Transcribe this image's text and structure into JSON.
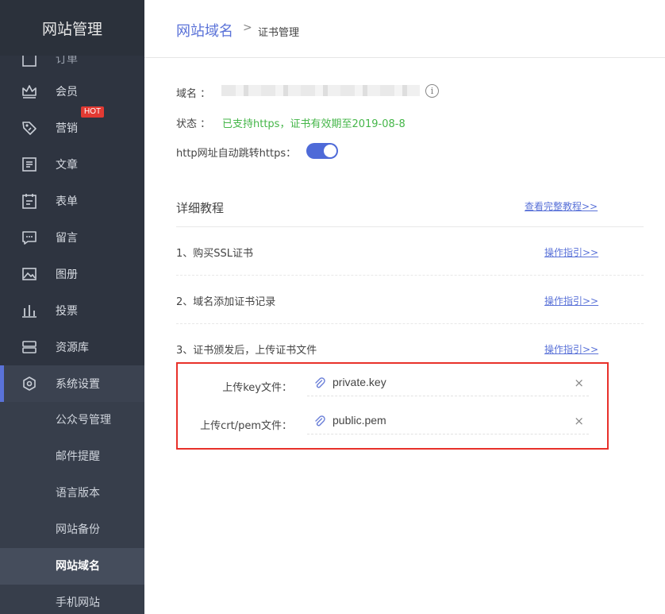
{
  "sidebar": {
    "brand": "网站管理",
    "partial_label": "订单",
    "hot_badge": "HOT",
    "items": [
      {
        "label": "会员",
        "icon": "crown-icon"
      },
      {
        "label": "营销",
        "icon": "tag-icon"
      },
      {
        "label": "文章",
        "icon": "article-icon"
      },
      {
        "label": "表单",
        "icon": "form-icon"
      },
      {
        "label": "留言",
        "icon": "message-icon"
      },
      {
        "label": "图册",
        "icon": "image-icon"
      },
      {
        "label": "投票",
        "icon": "bar-chart-icon"
      },
      {
        "label": "资源库",
        "icon": "storage-icon"
      },
      {
        "label": "系统设置",
        "icon": "settings-icon"
      }
    ],
    "subitems": [
      {
        "label": "公众号管理"
      },
      {
        "label": "邮件提醒"
      },
      {
        "label": "语言版本"
      },
      {
        "label": "网站备份"
      },
      {
        "label": "网站域名"
      },
      {
        "label": "手机网站"
      }
    ]
  },
  "header": {
    "breadcrumb_main": "网站域名",
    "breadcrumb_sep": ">",
    "breadcrumb_sub": "证书管理"
  },
  "info": {
    "domain_label": "域名 ：",
    "status_label": "状态 ：",
    "status_value": "已支持https，证书有效期至2019-08-8",
    "redirect_label": "http网址自动跳转https：",
    "redirect_enabled": true
  },
  "tutorial": {
    "title": "详细教程",
    "full_link": "查看完整教程>>",
    "steps": [
      {
        "text": "1、购买SSL证书",
        "link": "操作指引>>"
      },
      {
        "text": "2、域名添加证书记录",
        "link": "操作指引>>"
      },
      {
        "text": "3、证书颁发后，上传证书文件",
        "link": "操作指引>>"
      }
    ]
  },
  "upload": {
    "key_label": "上传key文件：",
    "key_file": "private.key",
    "crt_label": "上传crt/pem文件：",
    "crt_file": "public.pem",
    "remove_symbol": "×"
  },
  "colors": {
    "accent": "#5a72d8",
    "status_green": "#45b649",
    "highlight_red": "#e8312a",
    "sidebar_bg": "#2e3440"
  }
}
